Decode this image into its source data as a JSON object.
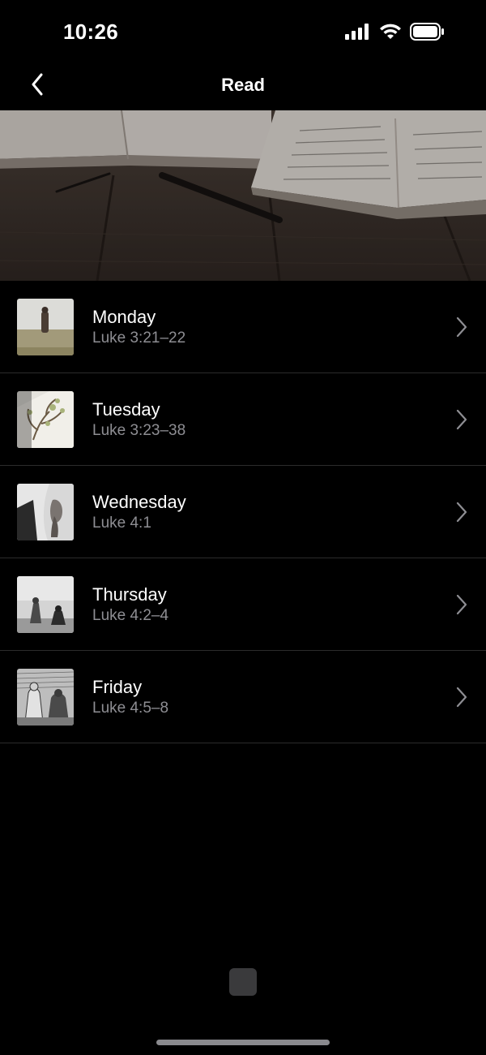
{
  "status_bar": {
    "time": "10:26"
  },
  "header": {
    "title": "Read",
    "back_icon": "chevron-left-icon"
  },
  "hero": {
    "image": "open-books-on-wooden-table"
  },
  "items": [
    {
      "title": "Monday",
      "subtitle": "Luke 3:21–22",
      "thumbnail": "figure-in-water"
    },
    {
      "title": "Tuesday",
      "subtitle": "Luke 3:23–38",
      "thumbnail": "family-tree-drawing"
    },
    {
      "title": "Wednesday",
      "subtitle": "Luke 4:1",
      "thumbnail": "hooded-figure-portrait"
    },
    {
      "title": "Thursday",
      "subtitle": "Luke 4:2–4",
      "thumbnail": "figures-in-desert"
    },
    {
      "title": "Friday",
      "subtitle": "Luke 4:5–8",
      "thumbnail": "engraving-temptation"
    }
  ],
  "colors": {
    "background": "#000000",
    "subtitle": "#8e8e93",
    "divider": "#2b2b2b",
    "chevron": "#8e8e93"
  }
}
